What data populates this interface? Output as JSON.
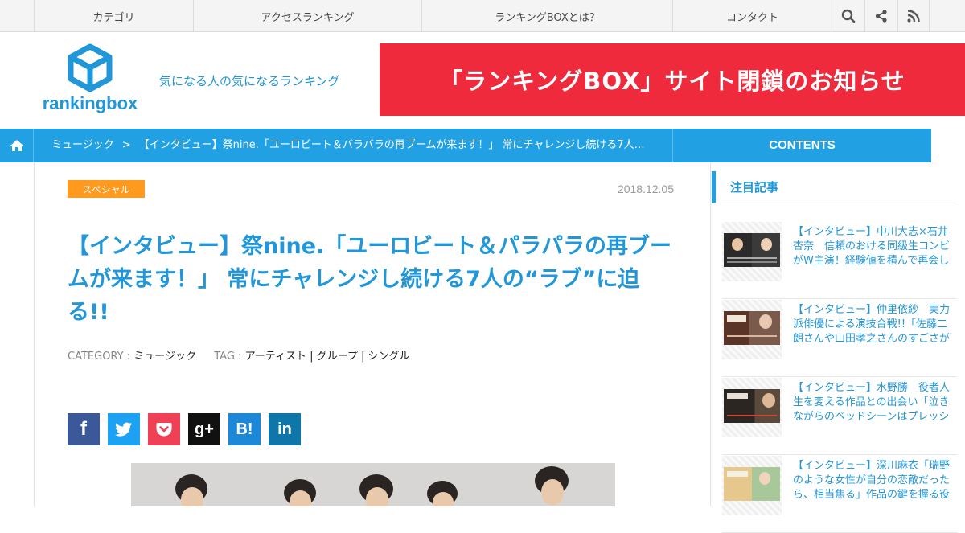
{
  "topnav": {
    "items": [
      "カテゴリ",
      "アクセスランキング",
      "ランキングBOXとは？",
      "コンタクト"
    ],
    "icons": [
      "search-icon",
      "share-icon",
      "rss-icon"
    ]
  },
  "header": {
    "logo_text": "rankingbox",
    "tagline": "気になる人の気になるランキング",
    "banner": "「ランキングBOX」サイト閉鎖のお知らせ"
  },
  "breadcrumb": {
    "category": "ミュージック",
    "separator": ">",
    "current": "【インタビュー】祭nine.「ユーロビート＆パラパラの再ブームが来ます！」 常にチャレンジし続ける7人…",
    "contents_label": "CONTENTS"
  },
  "article": {
    "category_badge": "スペシャル",
    "date": "2018.12.05",
    "title": "【インタビュー】祭nine.「ユーロビート＆パラパラの再ブームが来ます！」 常にチャレンジし続ける7人の“ラブ”に迫る!!",
    "category_label": "CATEGORY :",
    "category_value": "ミュージック",
    "tag_label": "TAG :",
    "tag_value": "アーティスト | グループ | シングル",
    "share_buttons": [
      {
        "label": "f",
        "icon": "facebook-icon",
        "color": "#3b5998"
      },
      {
        "label": "",
        "icon": "twitter-icon",
        "color": "#1da1f2"
      },
      {
        "label": "",
        "icon": "pocket-icon",
        "color": "#ef4056"
      },
      {
        "label": "g+",
        "icon": "google-plus-icon",
        "color": "#111111"
      },
      {
        "label": "B!",
        "icon": "hatena-icon",
        "color": "#1e88d8"
      },
      {
        "label": "in",
        "icon": "linkedin-icon",
        "color": "#0e76a8"
      }
    ]
  },
  "sidebar": {
    "title": "注目記事",
    "items": [
      {
        "text": "【インタビュー】中川大志×石井杏奈　信頼のおける同級生コンビがW主演！経験値を積んで再会し"
      },
      {
        "text": "【インタビュー】仲里依紗　実力派俳優による演技合戦!!「佐藤二朗さんや山田孝之さんのすごさが"
      },
      {
        "text": "【インタビュー】水野勝　役者人生を変える作品との出会い「泣きながらのベッドシーンはプレッシ"
      },
      {
        "text": "【インタビュー】深川麻衣「瑞野のような女性が自分の恋敵だったら、相当焦る」作品の鍵を握る役"
      }
    ]
  },
  "colors": {
    "brand": "#2196d8",
    "banner": "#ee2a3c",
    "badge": "#ff9a1f"
  }
}
